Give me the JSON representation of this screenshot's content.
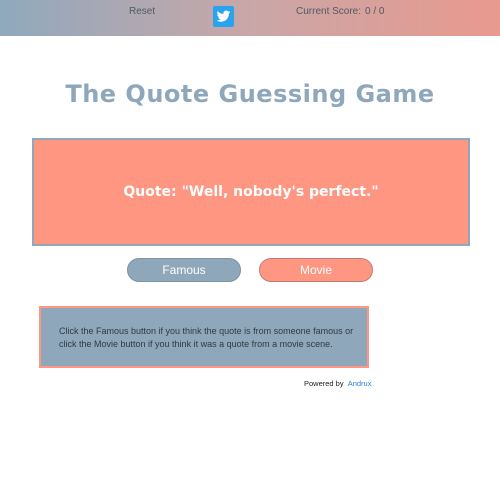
{
  "header": {
    "reset_label": "Reset",
    "twitter_icon": "twitter-bird-icon",
    "score_label": "Current Score:",
    "score_value": "0 / 0"
  },
  "title": "The Quote Guessing Game",
  "quote": {
    "label": "Quote:",
    "text": "\"Well, nobody's perfect.\""
  },
  "buttons": {
    "famous_label": "Famous",
    "movie_label": "Movie"
  },
  "instructions": "Click the Famous button if you think the quote is from someone famous or click the Movie button if you think it was a quote from a movie scene.",
  "footer": {
    "powered_label": "Powered by",
    "author_link": "Andrux"
  },
  "colors": {
    "accent_blue": "#8ea7ba",
    "accent_salmon": "#ff9682",
    "twitter_blue": "#2aa3ef",
    "link_blue": "#2e7de1"
  }
}
